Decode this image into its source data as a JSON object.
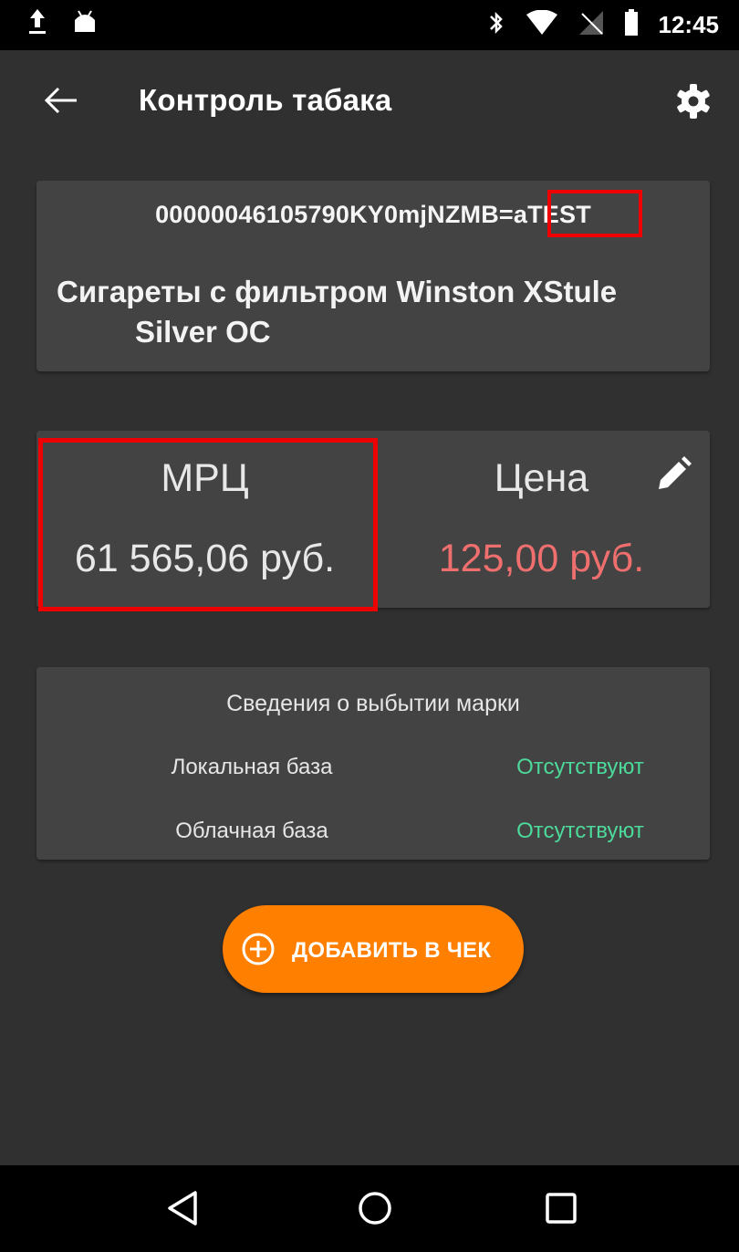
{
  "status_bar": {
    "time": "12:45",
    "icons": [
      "upload-icon",
      "android-icon",
      "bluetooth-icon",
      "wifi-icon",
      "no-signal-icon",
      "battery-icon"
    ]
  },
  "toolbar": {
    "title": "Контроль табака",
    "back_icon": "arrow-left-icon",
    "settings_icon": "gear-icon"
  },
  "product": {
    "code": "00000046105790KY0mjNZMB=aTEST",
    "name_line1": "Сигареты с фильтром Winston XStule",
    "name_line2": "Silver  OC"
  },
  "prices": {
    "mrc_label": "МРЦ",
    "mrc_value": "61 565,06 руб.",
    "price_label": "Цена",
    "price_value": "125,00 руб.",
    "price_color": "#ef6f6f",
    "edit_icon": "pencil-icon"
  },
  "disposal_info": {
    "title": "Сведения о выбытии марки",
    "rows": [
      {
        "label": "Локальная база",
        "value": "Отсутствуют"
      },
      {
        "label": "Облачная база",
        "value": "Отсутствуют"
      }
    ],
    "value_color": "#4cd99a"
  },
  "add_button": {
    "label": "ДОБАВИТЬ В ЧЕК",
    "icon": "plus-circle-icon",
    "color": "#ff7f00"
  },
  "nav_bar": {
    "buttons": [
      "back-triangle-icon",
      "home-circle-icon",
      "recents-square-icon"
    ]
  }
}
